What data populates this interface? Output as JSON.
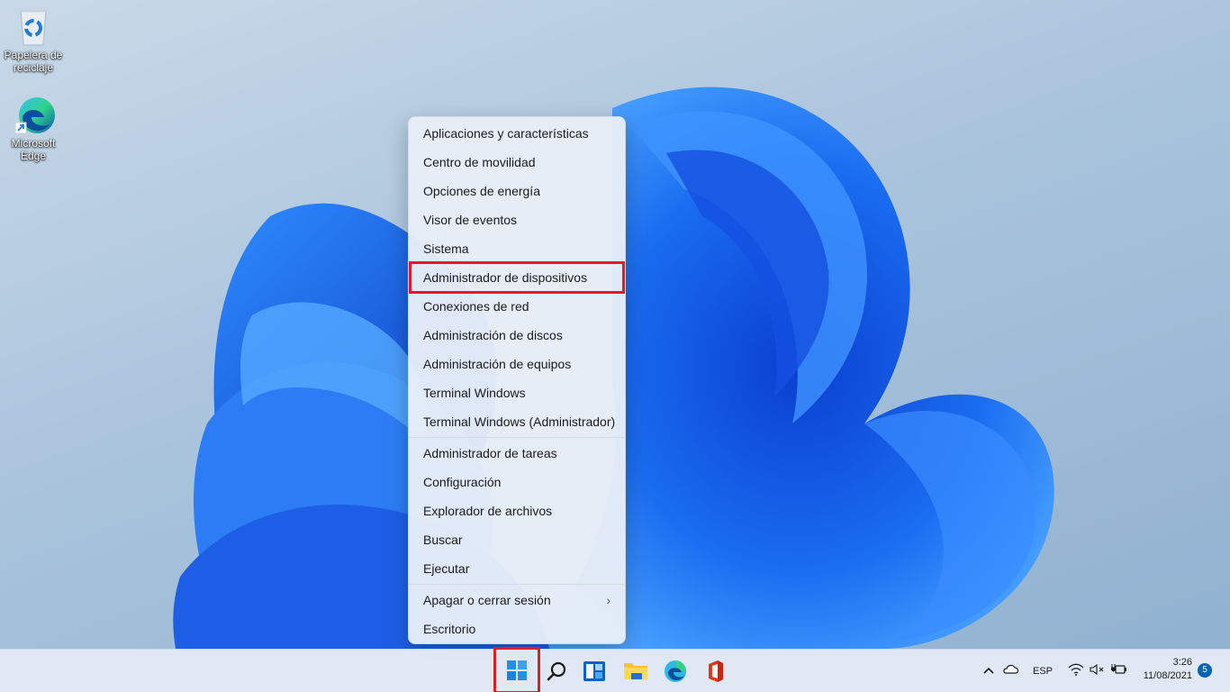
{
  "desktop": {
    "icons": [
      {
        "label": "Papelera de reciclaje",
        "icon": "recycle-bin-icon"
      },
      {
        "label": "Microsoft Edge",
        "icon": "edge-icon"
      }
    ]
  },
  "context_menu": {
    "groups": [
      [
        {
          "label": "Aplicaciones y características"
        },
        {
          "label": "Centro de movilidad"
        },
        {
          "label": "Opciones de energía"
        },
        {
          "label": "Visor de eventos"
        },
        {
          "label": "Sistema"
        },
        {
          "label": "Administrador de dispositivos",
          "highlighted": true
        },
        {
          "label": "Conexiones de red"
        },
        {
          "label": "Administración de discos"
        },
        {
          "label": "Administración de equipos"
        },
        {
          "label": "Terminal Windows"
        },
        {
          "label": "Terminal Windows (Administrador)"
        }
      ],
      [
        {
          "label": "Administrador de tareas"
        },
        {
          "label": "Configuración"
        },
        {
          "label": "Explorador de archivos"
        },
        {
          "label": "Buscar"
        },
        {
          "label": "Ejecutar"
        }
      ],
      [
        {
          "label": "Apagar o cerrar sesión",
          "submenu": true
        },
        {
          "label": "Escritorio"
        }
      ]
    ],
    "submenu_glyph": "›",
    "highlight_color": "#e31b23"
  },
  "taskbar": {
    "apps": [
      {
        "name": "start",
        "icon": "windows-start-icon",
        "highlighted": true
      },
      {
        "name": "search",
        "icon": "search-icon"
      },
      {
        "name": "widgets",
        "icon": "widgets-icon"
      },
      {
        "name": "file-explorer",
        "icon": "folder-icon"
      },
      {
        "name": "edge",
        "icon": "edge-icon"
      },
      {
        "name": "office",
        "icon": "office-icon"
      }
    ],
    "tray": {
      "chevron": "^",
      "language": "ESP",
      "time": "3:26",
      "date": "11/08/2021",
      "notifications": "5"
    }
  }
}
